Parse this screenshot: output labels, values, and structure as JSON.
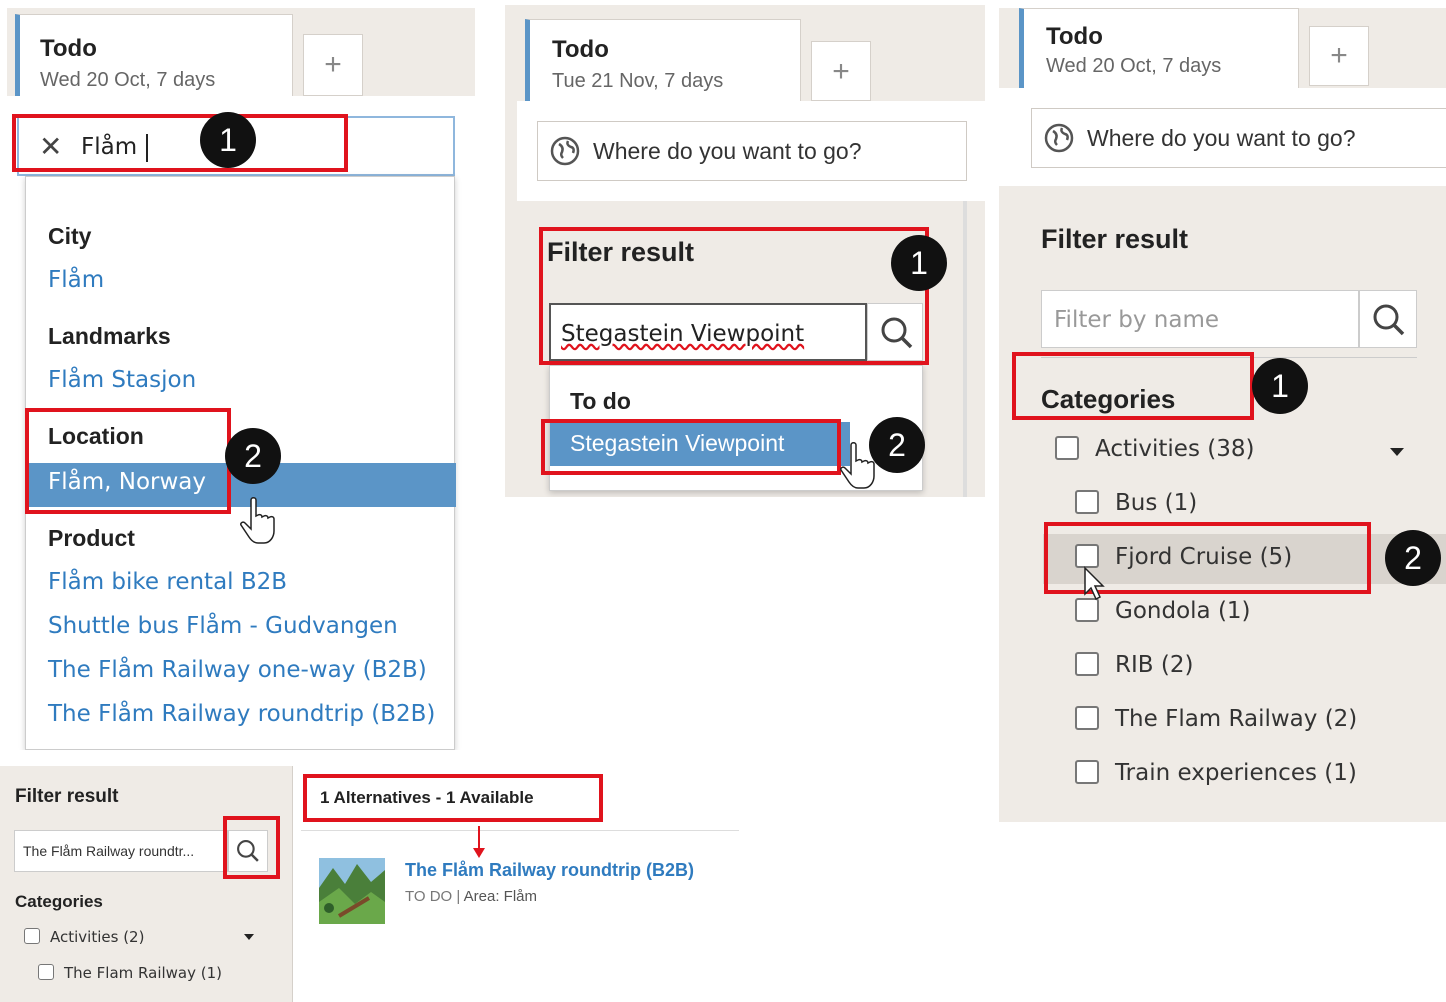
{
  "panel1": {
    "tab_title": "Todo",
    "tab_subtitle": "Wed 20 Oct, 7 days",
    "add_tab": "+",
    "search_value": "Flåm",
    "clear_symbol": "✕",
    "marker1": "1",
    "marker2": "2",
    "groups": [
      {
        "header": "City",
        "items": [
          "Flåm"
        ]
      },
      {
        "header": "Landmarks",
        "items": [
          "Flåm Stasjon"
        ]
      },
      {
        "header": "Location",
        "items": [
          "Flåm, Norway"
        ]
      },
      {
        "header": "Product",
        "items": [
          "Flåm bike rental B2B",
          "Shuttle bus Flåm - Gudvangen",
          "The Flåm Railway one-way (B2B)",
          "The Flåm Railway roundtrip (B2B)"
        ]
      }
    ]
  },
  "panel2": {
    "tab_title": "Todo",
    "tab_subtitle": "Tue 21 Nov, 7 days",
    "add_tab": "+",
    "where_placeholder": "Where do you want to go?",
    "filter_title": "Filter result",
    "filter_value": "Stegastein Viewpoint",
    "dropdown_header": "To do",
    "dropdown_item": "Stegastein Viewpoint",
    "marker1": "1",
    "marker2": "2"
  },
  "panel3": {
    "tab_title": "Todo",
    "tab_subtitle": "Wed 20 Oct, 7 days",
    "add_tab": "+",
    "where_placeholder": "Where do you want to go?",
    "filter_title": "Filter result",
    "filter_placeholder": "Filter by name",
    "categories_title": "Categories",
    "marker1": "1",
    "marker2": "2",
    "activities": "Activities (38)",
    "subcategories": [
      "Bus (1)",
      "Fjord Cruise (5)",
      "Gondola (1)",
      "RIB (2)",
      "The Flam Railway (2)",
      "Train experiences (1)"
    ]
  },
  "panel4": {
    "filter_title": "Filter result",
    "filter_value": "The Flåm Railway roundtr...",
    "categories_title": "Categories",
    "activities": "Activities (2)",
    "subcategory": "The Flam Railway (1)",
    "alternatives": "1 Alternatives - 1 Available",
    "product_title": "The Flåm Railway roundtrip (B2B)",
    "product_type": "TO DO",
    "product_area": "Area: Flåm"
  },
  "colors": {
    "accent_red": "#e0131d",
    "link_blue": "#2f7bbf",
    "selected_blue": "#5b95c7",
    "panel_bg": "#efebe6"
  }
}
